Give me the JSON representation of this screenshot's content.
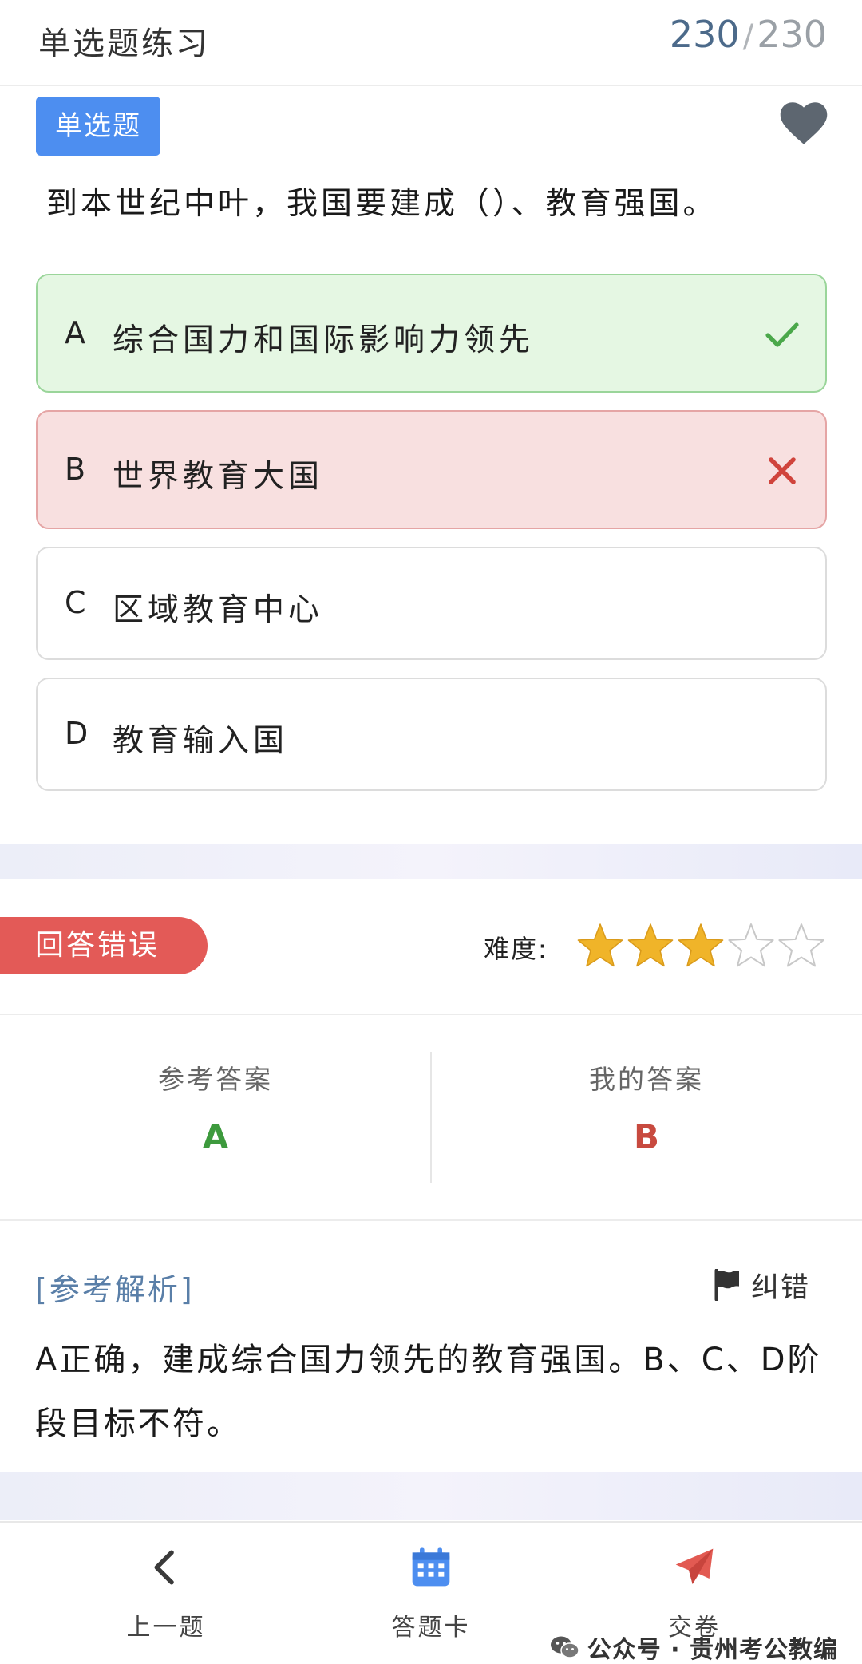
{
  "header": {
    "title": "单选题练习",
    "current": "230",
    "separator": "/",
    "total": "230"
  },
  "question": {
    "type_label": "单选题",
    "text": "到本世纪中叶，我国要建成（）、教育强国。",
    "options": [
      {
        "letter": "A",
        "text": "综合国力和国际影响力领先",
        "state": "correct"
      },
      {
        "letter": "B",
        "text": "世界教育大国",
        "state": "wrong"
      },
      {
        "letter": "C",
        "text": "区域教育中心",
        "state": "none"
      },
      {
        "letter": "D",
        "text": "教育输入国",
        "state": "none"
      }
    ]
  },
  "result": {
    "label": "回答错误",
    "difficulty_label": "难度:",
    "difficulty_stars": 3,
    "difficulty_max": 5
  },
  "answers": {
    "reference_label": "参考答案",
    "reference_value": "A",
    "mine_label": "我的答案",
    "mine_value": "B"
  },
  "analysis": {
    "title": "[参考解析]",
    "report_label": "纠错",
    "text": "A正确，建成综合国力领先的教育强国。B、C、D阶段目标不符。"
  },
  "bottom_nav": {
    "prev_label": "上一题",
    "card_label": "答题卡",
    "submit_label": "交卷"
  },
  "watermark": {
    "text": "公众号 · 贵州考公教编"
  },
  "colors": {
    "correct": "#3d9a3d",
    "wrong": "#c84a3f",
    "badge_blue": "#4d8ef0",
    "result_red": "#e35a57",
    "star_gold": "#f0b429"
  }
}
